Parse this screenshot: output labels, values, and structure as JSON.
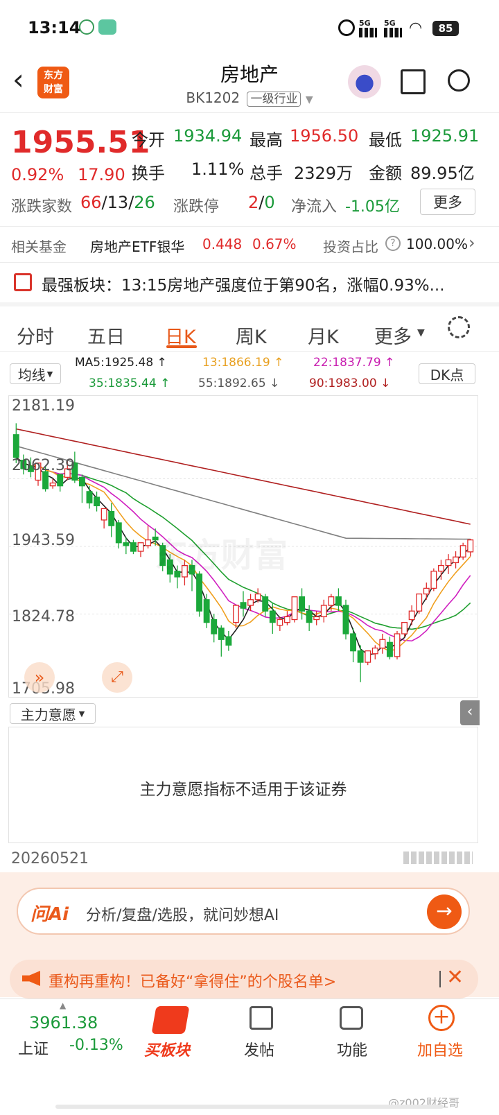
{
  "status_bar": {
    "time": "13:14",
    "battery": "85",
    "network1": "5G",
    "network2": "5G"
  },
  "header": {
    "title": "房地产",
    "code": "BK1202",
    "industry_tag": "一级行业",
    "logo_line1": "东方",
    "logo_line2": "财富"
  },
  "quote": {
    "price": "1955.51",
    "change_pct": "0.92%",
    "change": "17.90",
    "open_label": "今开",
    "open": "1934.94",
    "high_label": "最高",
    "high": "1956.50",
    "low_label": "最低",
    "low": "1925.91",
    "turnover_label": "换手",
    "turnover": "1.11%",
    "volume_label": "总手",
    "volume": "2329万",
    "amount_label": "金额",
    "amount": "89.95亿",
    "updown_label": "涨跌家数",
    "up": "66",
    "flat": "13",
    "down": "26",
    "sep": "/",
    "limit_label": "涨跌停",
    "limit_up": "2",
    "limit_down": "0",
    "netflow_label": "净流入",
    "netflow": "-1.05亿",
    "more_label": "更多"
  },
  "fund": {
    "label": "相关基金",
    "name": "房地产ETF银华",
    "price": "0.448",
    "pct": "0.67%",
    "ratio_label": "投资占比",
    "ratio": "100.00%"
  },
  "banner": {
    "text": "最强板块：13:15房地产强度位于第90名，涨幅0.93%..."
  },
  "tabs": [
    "分时",
    "五日",
    "日K",
    "周K",
    "月K",
    "更多"
  ],
  "ma": {
    "selector": "均线",
    "ma5": "MA5:1925.48 ↑",
    "ma13": "13:1866.19 ↑",
    "ma22": "22:1837.79 ↑",
    "ma35": "35:1835.44 ↑",
    "ma55": "55:1892.65 ↓",
    "ma90": "90:1983.00 ↓",
    "dk": "DK点"
  },
  "chart_data": {
    "type": "candlestick",
    "y_ticks": [
      "2181.19",
      "2062.39",
      "1943.59",
      "1824.78",
      "1705.98"
    ],
    "ylim": [
      1705.98,
      2181.19
    ],
    "series_colors": {
      "ma5": "#222222",
      "ma13": "#f0a020",
      "ma22": "#d020c0",
      "ma35": "#20a030",
      "ma55": "#808080",
      "ma90": "#b02020"
    },
    "candles": [
      [
        2140,
        2160,
        2100,
        2090
      ],
      [
        2095,
        2105,
        2080,
        2070
      ],
      [
        2085,
        2100,
        2075,
        2065
      ],
      [
        2060,
        2075,
        2090,
        2050
      ],
      [
        2075,
        2085,
        2045,
        2040
      ],
      [
        2050,
        2062,
        2055,
        2045
      ],
      [
        2070,
        2070,
        2050,
        2040
      ],
      [
        2065,
        2095,
        2080,
        2060
      ],
      [
        2090,
        2110,
        2060,
        2055
      ],
      [
        2065,
        2070,
        2050,
        2020
      ],
      [
        2040,
        2050,
        2020,
        2010
      ],
      [
        2030,
        2040,
        2015,
        2005
      ],
      [
        1990,
        2000,
        2010,
        1975
      ],
      [
        2005,
        2020,
        1980,
        1960
      ],
      [
        1985,
        1990,
        1950,
        1940
      ],
      [
        1950,
        1960,
        1945,
        1930
      ],
      [
        1950,
        1955,
        1935,
        1930
      ],
      [
        1935,
        1950,
        1950,
        1925
      ],
      [
        1945,
        1980,
        1955,
        1940
      ],
      [
        1960,
        1975,
        1955,
        1945
      ],
      [
        1945,
        1950,
        1910,
        1900
      ],
      [
        1920,
        1930,
        1895,
        1880
      ],
      [
        1900,
        1910,
        1890,
        1870
      ],
      [
        1890,
        1920,
        1910,
        1875
      ],
      [
        1910,
        1920,
        1895,
        1865
      ],
      [
        1895,
        1900,
        1830,
        1820
      ],
      [
        1850,
        1860,
        1810,
        1800
      ],
      [
        1815,
        1825,
        1790,
        1775
      ],
      [
        1800,
        1805,
        1780,
        1750
      ],
      [
        1785,
        1795,
        1770,
        1760
      ],
      [
        1810,
        1830,
        1840,
        1800
      ],
      [
        1845,
        1865,
        1835,
        1820
      ],
      [
        1840,
        1860,
        1850,
        1830
      ],
      [
        1850,
        1870,
        1860,
        1845
      ],
      [
        1855,
        1860,
        1830,
        1820
      ],
      [
        1830,
        1845,
        1810,
        1790
      ],
      [
        1805,
        1820,
        1815,
        1795
      ],
      [
        1810,
        1830,
        1820,
        1805
      ],
      [
        1815,
        1830,
        1855,
        1810
      ],
      [
        1855,
        1870,
        1830,
        1815
      ],
      [
        1830,
        1840,
        1810,
        1795
      ],
      [
        1815,
        1830,
        1820,
        1805
      ],
      [
        1820,
        1850,
        1840,
        1810
      ],
      [
        1840,
        1860,
        1855,
        1830
      ],
      [
        1855,
        1870,
        1840,
        1830
      ],
      [
        1840,
        1850,
        1790,
        1780
      ],
      [
        1790,
        1800,
        1760,
        1740
      ],
      [
        1760,
        1770,
        1740,
        1705
      ],
      [
        1740,
        1755,
        1760,
        1735
      ],
      [
        1755,
        1770,
        1765,
        1745
      ],
      [
        1765,
        1790,
        1780,
        1755
      ],
      [
        1775,
        1785,
        1750,
        1745
      ],
      [
        1750,
        1795,
        1790,
        1745
      ],
      [
        1790,
        1805,
        1810,
        1785
      ],
      [
        1815,
        1840,
        1830,
        1805
      ],
      [
        1830,
        1860,
        1860,
        1825
      ],
      [
        1860,
        1880,
        1870,
        1850
      ],
      [
        1870,
        1905,
        1900,
        1865
      ],
      [
        1900,
        1920,
        1910,
        1885
      ],
      [
        1910,
        1930,
        1920,
        1895
      ],
      [
        1915,
        1935,
        1925,
        1905
      ],
      [
        1925,
        1950,
        1945,
        1920
      ],
      [
        1934,
        1957,
        1955,
        1926
      ]
    ]
  },
  "indicator": {
    "selector": "主力意愿",
    "message": "主力意愿指标不适用于该证券"
  },
  "date": "20260521",
  "ai": {
    "logo": "问Ai",
    "placeholder": "分析/复盘/选股，就问妙想AI"
  },
  "notice": {
    "text": "重构再重构！已备好“拿得住”的个股名单>"
  },
  "bottom_nav": {
    "index_value": "3961.38",
    "index_name": "上证",
    "index_pct": "-0.13%",
    "items": [
      "买板块",
      "发帖",
      "功能",
      "加自选"
    ]
  },
  "watermark": "@z002财经哥"
}
